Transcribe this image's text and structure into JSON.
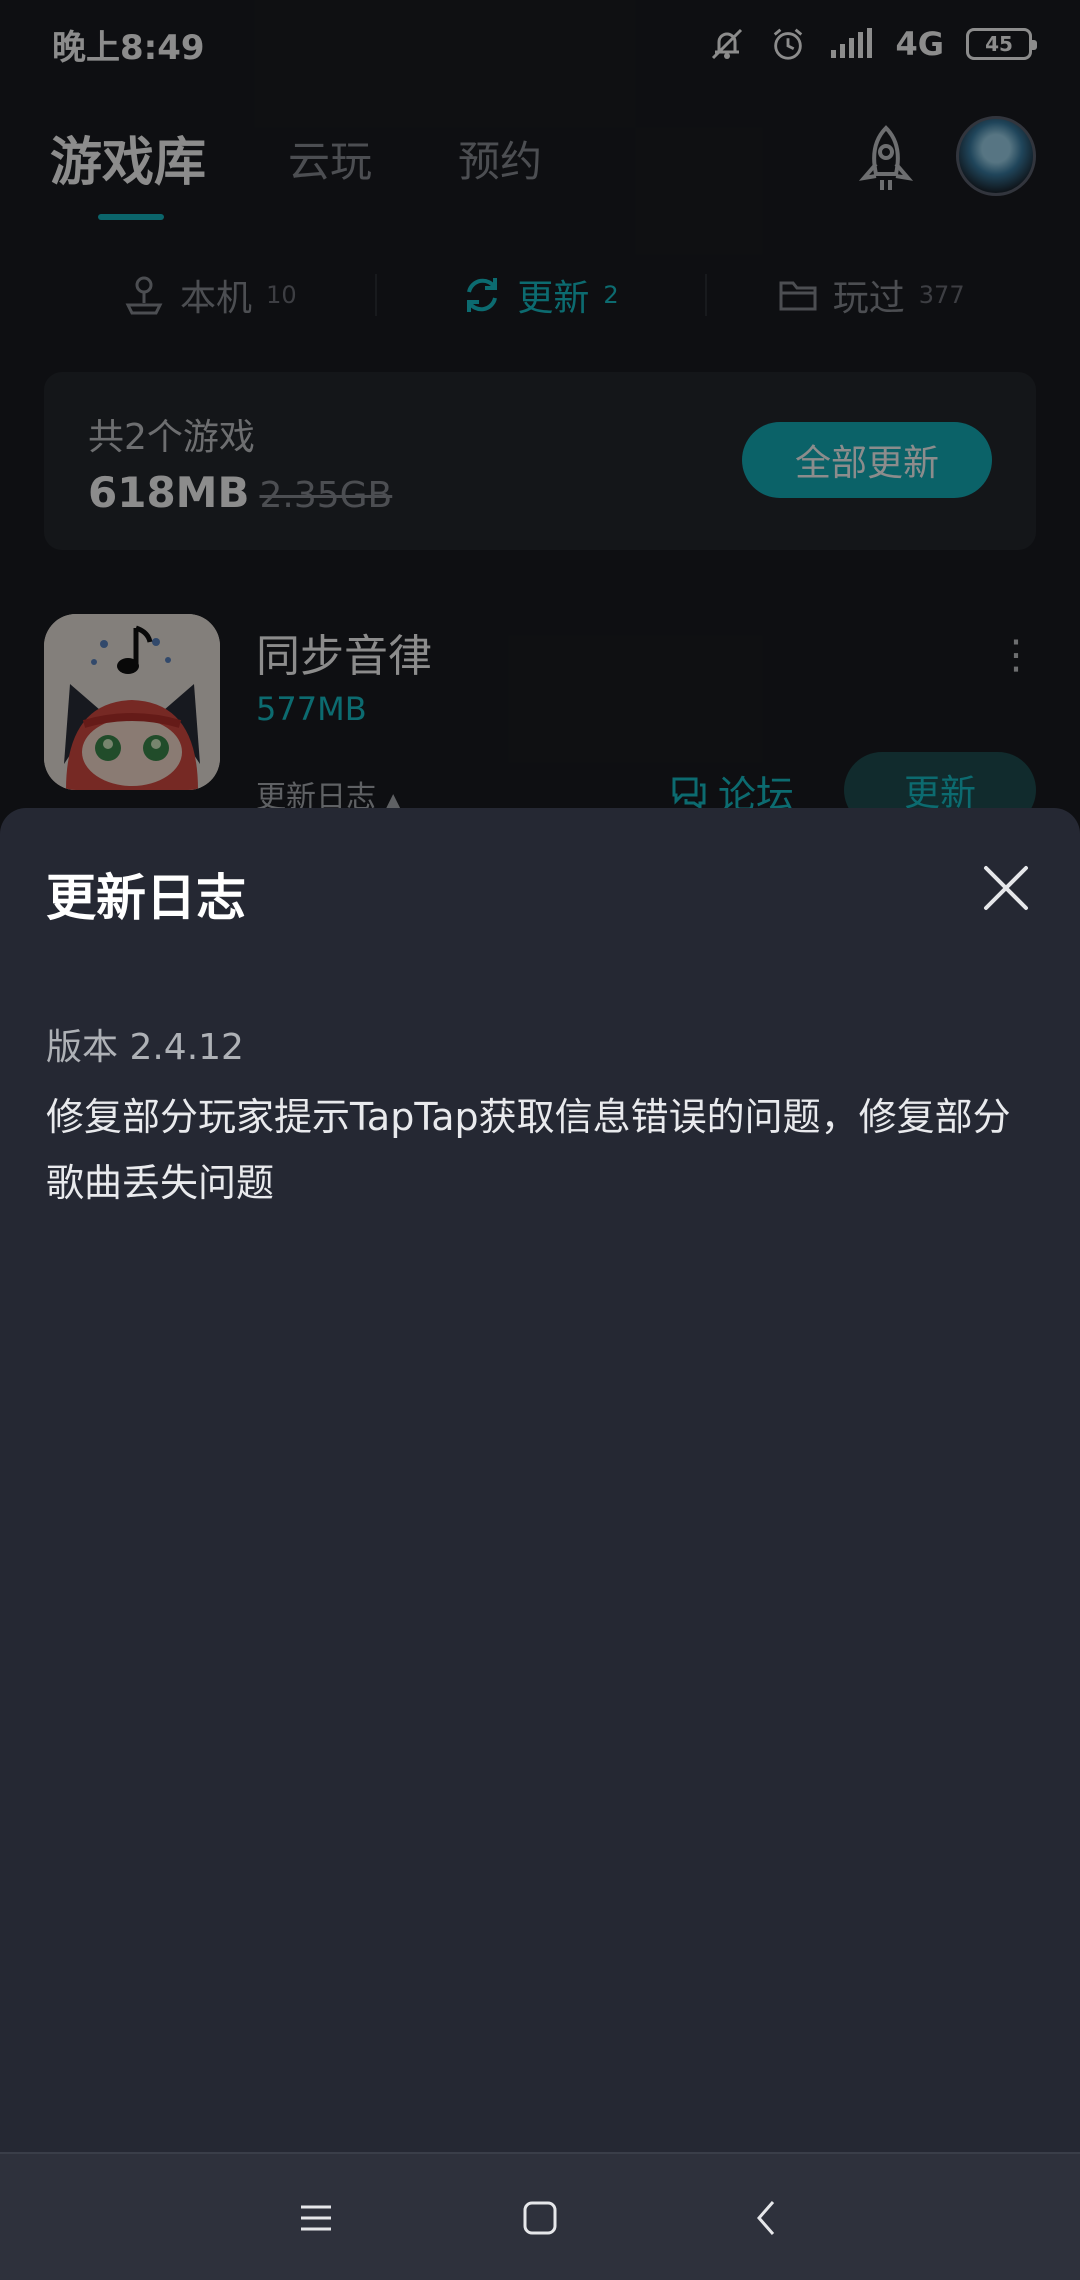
{
  "status_bar": {
    "time": "晚上8:49",
    "network": "4G",
    "battery": "45",
    "icons": [
      "mute-icon",
      "alarm-icon",
      "signal-icon"
    ]
  },
  "top_nav": {
    "tabs": [
      {
        "label": "游戏库",
        "active": true
      },
      {
        "label": "云玩",
        "active": false
      },
      {
        "label": "预约",
        "active": false
      }
    ],
    "icons": [
      "rocket-icon",
      "avatar"
    ]
  },
  "sub_tabs": [
    {
      "label": "本机",
      "count": "10",
      "icon": "joystick-icon"
    },
    {
      "label": "更新",
      "count": "2",
      "icon": "refresh-icon",
      "active": true
    },
    {
      "label": "玩过",
      "count": "377",
      "icon": "folder-icon"
    }
  ],
  "summary": {
    "count_text": "共2个游戏",
    "size": "618MB",
    "original_size": "2.35GB",
    "update_all_label": "全部更新"
  },
  "game": {
    "title": "同步音律",
    "size": "577MB",
    "changelog_label": "更新日志",
    "forum_label": "论坛",
    "update_label": "更新"
  },
  "sheet": {
    "title": "更新日志",
    "version": "版本 2.4.12",
    "notes": "修复部分玩家提示TapTap获取信息错误的问题，修复部分歌曲丢失问题"
  },
  "colors": {
    "accent": "#17c3cc",
    "sheet_bg": "#252833",
    "page_bg": "#1b1d21"
  }
}
